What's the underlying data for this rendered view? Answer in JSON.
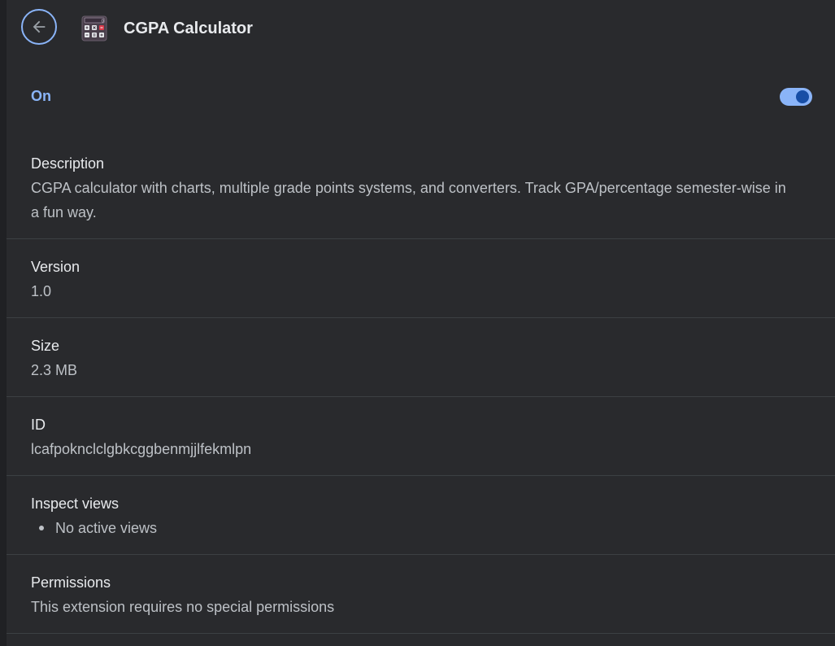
{
  "header": {
    "title": "CGPA Calculator",
    "back_icon": "arrow-left-icon",
    "app_icon": "calculator-icon"
  },
  "toggle": {
    "label": "On",
    "state": true
  },
  "sections": {
    "description": {
      "label": "Description",
      "value": "CGPA calculator with charts, multiple grade points systems, and converters. Track GPA/percentage semester-wise in a fun way."
    },
    "version": {
      "label": "Version",
      "value": "1.0"
    },
    "size": {
      "label": "Size",
      "value": "2.3 MB"
    },
    "id": {
      "label": "ID",
      "value": "lcafpokncl​clgbkcggbenmjjlfekmlpn"
    },
    "inspect_views": {
      "label": "Inspect views",
      "items": [
        "No active views"
      ]
    },
    "permissions": {
      "label": "Permissions",
      "value": "This extension requires no special permissions"
    }
  },
  "colors": {
    "accent": "#8ab4f8",
    "background": "#292a2d",
    "text": "#e8eaed"
  }
}
